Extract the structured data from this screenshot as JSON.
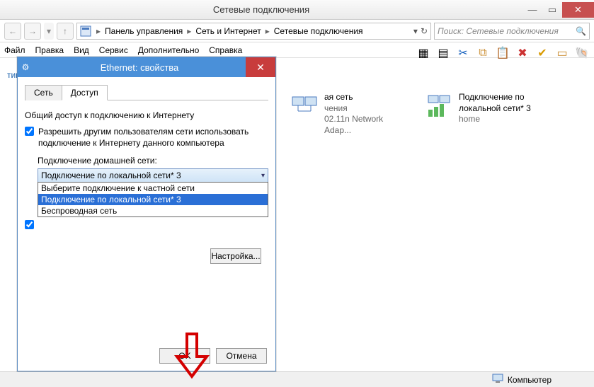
{
  "window": {
    "title": "Сетевые подключения",
    "breadcrumb": {
      "a": "Панель управления",
      "b": "Сеть и Интернет",
      "c": "Сетевые подключения"
    },
    "search_placeholder": "Поиск: Сетевые подключения"
  },
  "menu": {
    "file": "Файл",
    "edit": "Правка",
    "view": "Вид",
    "service": "Сервис",
    "extra": "Дополнительно",
    "help": "Справка"
  },
  "cmdbar": {
    "diag": "тика подключения",
    "more": "»"
  },
  "connections": [
    {
      "l1": "ая сеть",
      "l2": "чения",
      "l3": "02.11n Network Adap..."
    },
    {
      "l1": "Подключение по локальной сети* 3",
      "l2": "home",
      "l3": ""
    }
  ],
  "statusbar": {
    "label": "Компьютер"
  },
  "dialog": {
    "title": "Ethernet: свойства",
    "tabs": {
      "net": "Сеть",
      "share": "Доступ"
    },
    "group_title": "Общий доступ к подключению к Интернету",
    "chk1": "Разрешить другим пользователям сети использовать подключение к Интернету данного компьютера",
    "home_label": "Подключение домашней сети:",
    "combo_value": "Подключение по локальной сети* 3",
    "options": {
      "o1": "Выберите подключение к частной сети",
      "o2": "Подключение по локальной сети* 3",
      "o3": "Беспроводная сеть"
    },
    "settings_btn": "Настройка...",
    "ok": "OK",
    "cancel": "Отмена"
  }
}
